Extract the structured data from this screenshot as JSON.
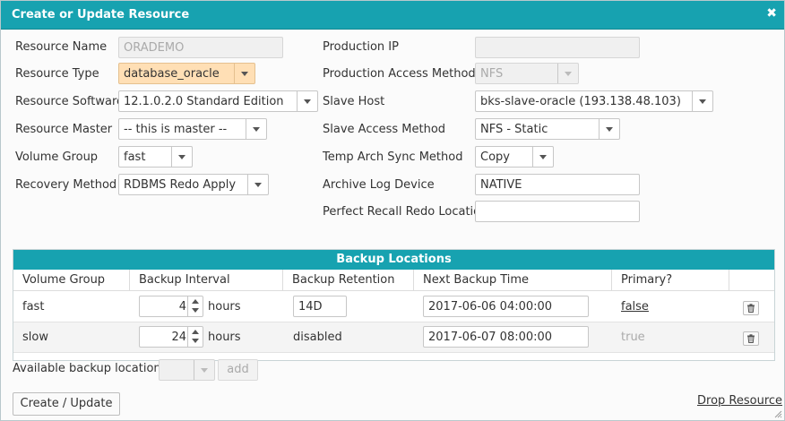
{
  "dialog": {
    "title": "Create or Update Resource",
    "close_icon": "✖"
  },
  "left": {
    "resource_name_label": "Resource Name",
    "resource_name_value": "ORADEMO",
    "resource_type_label": "Resource Type",
    "resource_type_value": "database_oracle",
    "resource_software_label": "Resource Software",
    "resource_software_value": "12.1.0.2.0 Standard Edition",
    "resource_master_label": "Resource Master",
    "resource_master_value": "-- this is master --",
    "volume_group_label": "Volume Group",
    "volume_group_value": "fast",
    "recovery_method_label": "Recovery Method",
    "recovery_method_value": "RDBMS Redo Apply"
  },
  "right": {
    "production_ip_label": "Production IP",
    "production_ip_value": "",
    "production_access_label": "Production Access Method",
    "production_access_value": "NFS",
    "slave_host_label": "Slave Host",
    "slave_host_value": "bks-slave-oracle (193.138.48.103)",
    "slave_access_label": "Slave Access Method",
    "slave_access_value": "NFS - Static",
    "temp_arch_label": "Temp Arch Sync Method",
    "temp_arch_value": "Copy",
    "archive_log_label": "Archive Log Device",
    "archive_log_value": "NATIVE",
    "perfect_recall_label": "Perfect Recall Redo Location",
    "perfect_recall_value": ""
  },
  "backup": {
    "title": "Backup Locations",
    "columns": [
      "Volume Group",
      "Backup Interval",
      "Backup Retention",
      "Next Backup Time",
      "Primary?"
    ],
    "unit": "hours",
    "rows": [
      {
        "volume_group": "fast",
        "interval": "4",
        "retention": "14D",
        "next_time": "2017-06-06 04:00:00",
        "primary": "false"
      },
      {
        "volume_group": "slow",
        "interval": "24",
        "retention": "disabled",
        "next_time": "2017-06-07 08:00:00",
        "primary": "true"
      }
    ]
  },
  "available": {
    "label": "Available backup locations:",
    "value": "",
    "add_label": "add"
  },
  "footer": {
    "submit_label": "Create / Update",
    "drop_label": "Drop Resource"
  },
  "colors": {
    "accent": "#17a2b0",
    "highlight": "#ffdfb5"
  }
}
